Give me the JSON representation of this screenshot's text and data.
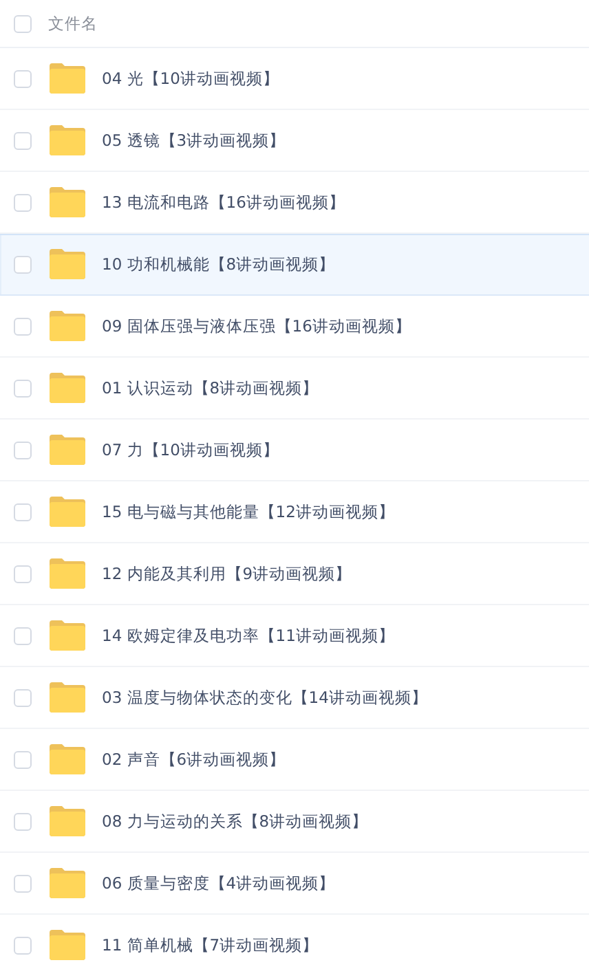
{
  "header": {
    "checked": false,
    "label": "文件名"
  },
  "rows": [
    {
      "name": "04 光【10讲动画视频】",
      "checked": false,
      "selected": false
    },
    {
      "name": "05 透镜【3讲动画视频】",
      "checked": false,
      "selected": false
    },
    {
      "name": "13 电流和电路【16讲动画视频】",
      "checked": false,
      "selected": false
    },
    {
      "name": "10 功和机械能【8讲动画视频】",
      "checked": false,
      "selected": true
    },
    {
      "name": "09 固体压强与液体压强【16讲动画视频】",
      "checked": false,
      "selected": false
    },
    {
      "name": "01 认识运动【8讲动画视频】",
      "checked": false,
      "selected": false
    },
    {
      "name": "07 力【10讲动画视频】",
      "checked": false,
      "selected": false
    },
    {
      "name": "15 电与磁与其他能量【12讲动画视频】",
      "checked": false,
      "selected": false
    },
    {
      "name": "12 内能及其利用【9讲动画视频】",
      "checked": false,
      "selected": false
    },
    {
      "name": "14 欧姆定律及电功率【11讲动画视频】",
      "checked": false,
      "selected": false
    },
    {
      "name": "03 温度与物体状态的变化【14讲动画视频】",
      "checked": false,
      "selected": false
    },
    {
      "name": "02 声音【6讲动画视频】",
      "checked": false,
      "selected": false
    },
    {
      "name": "08 力与运动的关系【8讲动画视频】",
      "checked": false,
      "selected": false
    },
    {
      "name": "06 质量与密度【4讲动画视频】",
      "checked": false,
      "selected": false
    },
    {
      "name": "11 简单机械【7讲动画视频】",
      "checked": false,
      "selected": false
    }
  ]
}
